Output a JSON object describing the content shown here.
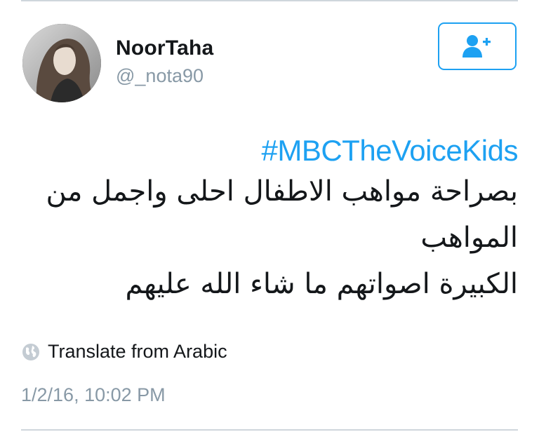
{
  "user": {
    "display_name": "NoorTaha",
    "handle": "@_nota90"
  },
  "follow_button": {
    "icon": "add-user-icon"
  },
  "tweet": {
    "hashtag": "#MBCTheVoiceKids",
    "lines": [
      "بصراحة مواهب الاطفال احلى واجمل من",
      "المواهب",
      "الكبيرة اصواتهم ما شاء الله عليهم"
    ],
    "translate_label": "Translate from Arabic",
    "timestamp": "1/2/16, 10:02 PM"
  },
  "colors": {
    "accent": "#1da1f2",
    "text": "#14171a",
    "secondary_text": "#8899a6",
    "border": "#cfd6dc"
  }
}
